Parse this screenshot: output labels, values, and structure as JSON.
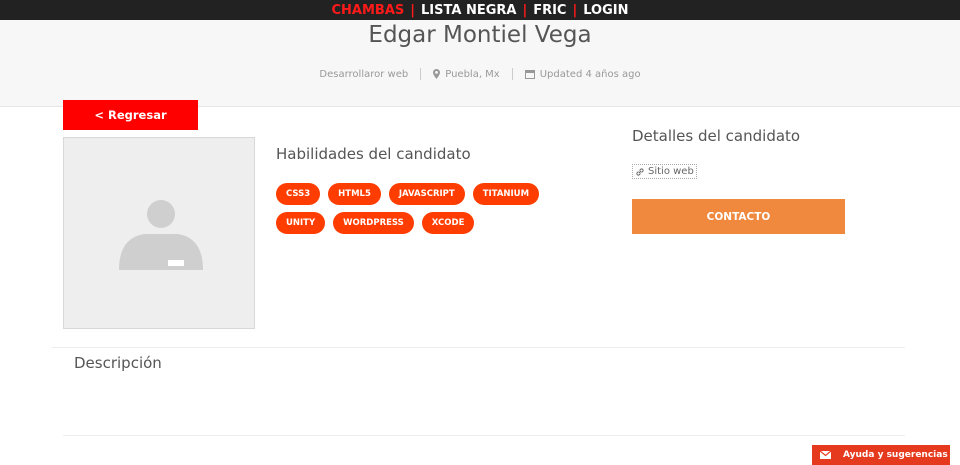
{
  "nav": {
    "items": [
      {
        "label": "CHAMBAS",
        "active": true
      },
      {
        "label": "LISTA NEGRA",
        "active": false
      },
      {
        "label": "FRIC",
        "active": false
      },
      {
        "label": "LOGIN",
        "active": false
      }
    ],
    "separator": "|"
  },
  "profile": {
    "name": "Edgar Montiel Vega",
    "role": "Desarrollaror web",
    "location": "Puebla, Mx",
    "updated": "Updated 4 años ago"
  },
  "back_button": "< Regresar",
  "skills": {
    "title": "Habilidades del candidato",
    "items": [
      "CSS3",
      "HTML5",
      "JAVASCRIPT",
      "TITANIUM",
      "UNITY",
      "WORDPRESS",
      "XCODE"
    ]
  },
  "details": {
    "title": "Detalles del candidato",
    "website_label": "Sitio web",
    "contact_button": "CONTACTO"
  },
  "description": {
    "title": "Descripción"
  },
  "help_button": "Ayuda y sugerencias",
  "colors": {
    "nav_bg": "#222222",
    "accent_red": "#ff0000",
    "skill_chip": "#ff3d00",
    "contact_orange": "#f0883e"
  },
  "icons": {
    "location": "map-pin-icon",
    "updated": "calendar-icon",
    "website": "link-icon",
    "help": "envelope-icon",
    "avatar": "user-placeholder-icon"
  }
}
